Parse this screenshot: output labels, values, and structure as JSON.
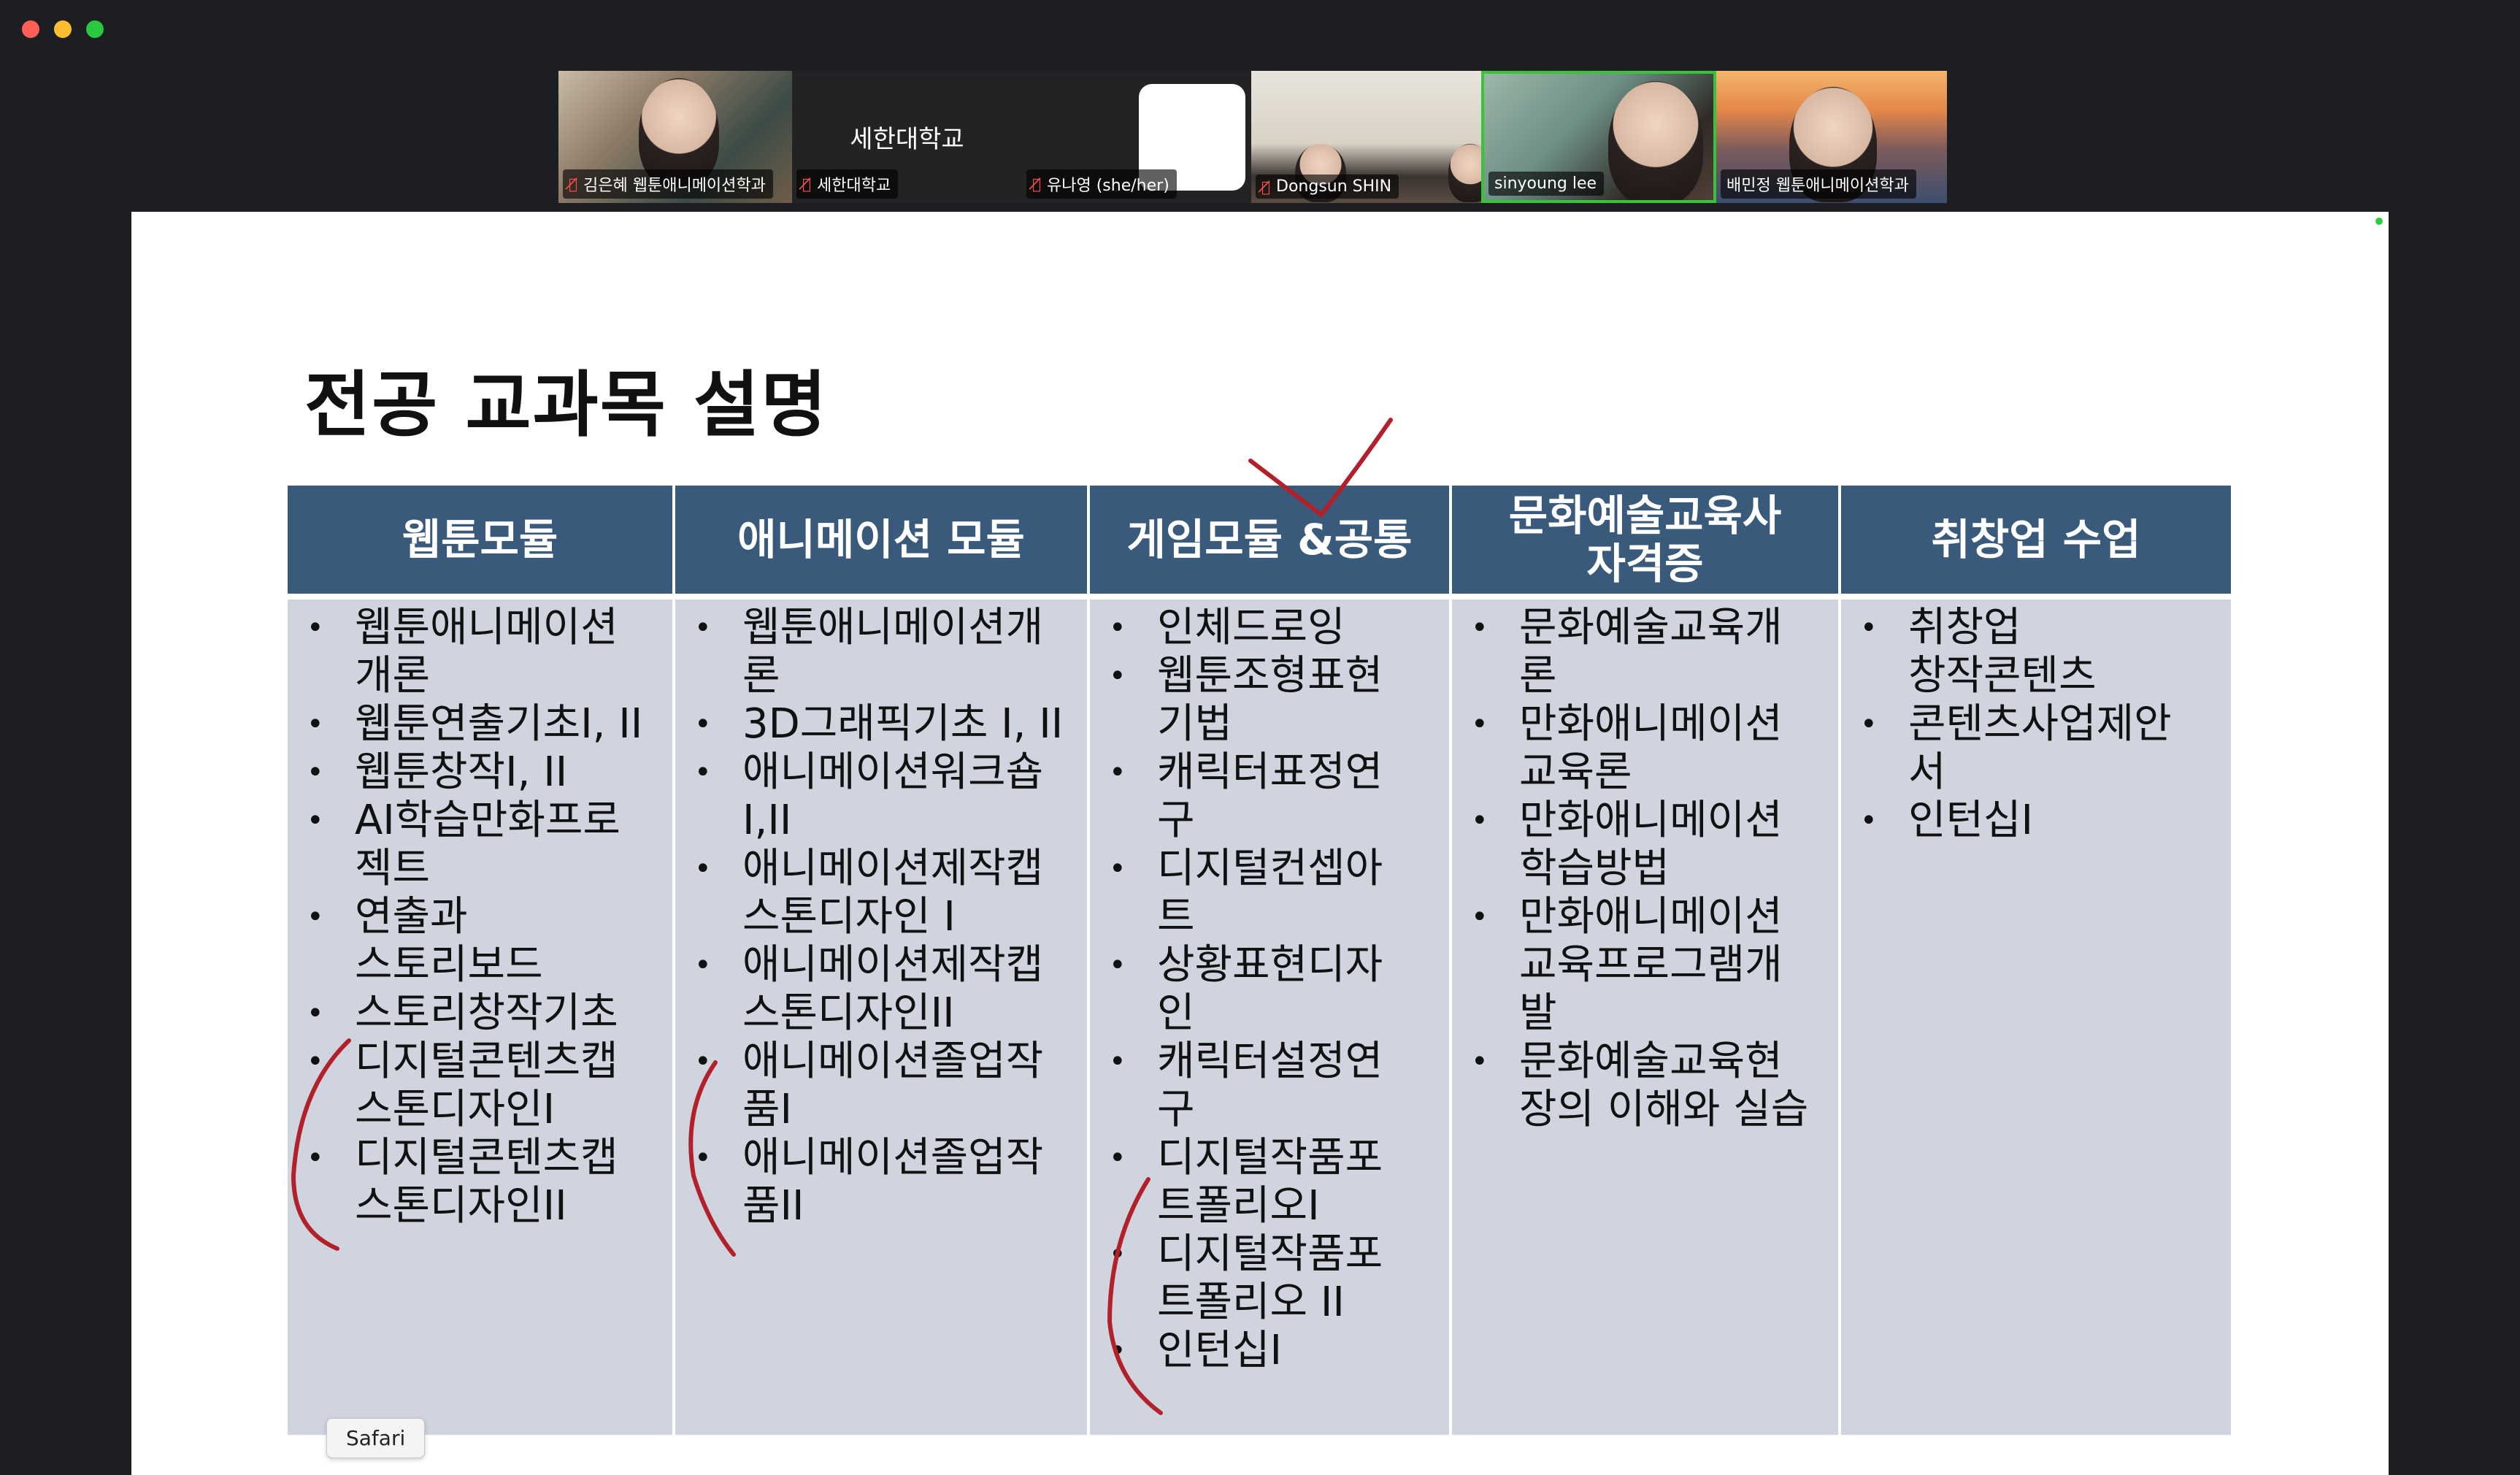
{
  "participants": [
    {
      "name": "김은혜 웹툰애니메이션학과",
      "muted": true
    },
    {
      "name": "세한대학교",
      "display_name": "세한대학교",
      "muted": true
    },
    {
      "name": "유나영 (she/her)",
      "muted": true
    },
    {
      "name": "Dongsun SHIN",
      "muted": true
    },
    {
      "name": "sinyoung lee",
      "muted": false,
      "active_speaker": true
    },
    {
      "name": "배민정 웹툰애니메이션학과",
      "muted": false
    }
  ],
  "slide": {
    "title": "전공 교과목 설명",
    "columns": [
      {
        "header": "웹툰모듈",
        "items": [
          "웹툰애니메이션\n개론",
          "웹툰연출기초I, II",
          "웹툰창작I, II",
          "AI학습만화프로\n젝트",
          "연출과\n스토리보드",
          "스토리창작기초",
          "디지털콘텐츠캡\n스톤디자인I",
          "디지털콘텐츠캡\n스톤디자인II"
        ]
      },
      {
        "header": "애니메이션 모듈",
        "items": [
          "웹툰애니메이션개\n론",
          "3D그래픽기초 I, II",
          "애니메이션워크숍\nI,II",
          "애니메이션제작캡\n스톤디자인 I",
          "애니메이션제작캡\n스톤디자인II",
          "애니메이션졸업작\n품I",
          "애니메이션졸업작\n품II"
        ]
      },
      {
        "header": "게임모듈 &공통",
        "items": [
          "인체드로잉",
          "웹툰조형표현\n기법",
          "캐릭터표정연\n구",
          "디지털컨셉아\n트",
          "상황표현디자\n인",
          "캐릭터설정연\n구",
          "디지털작품포\n트폴리오I",
          "디지털작품포\n트폴리오 II",
          "인턴십I"
        ]
      },
      {
        "header": "문화예술교육사\n자격증",
        "items": [
          "문화예술교육개\n론",
          "만화애니메이션\n교육론",
          "만화애니메이션\n학습방법",
          "만화애니메이션\n교육프로그램개\n발",
          "문화예술교육현\n장의 이해와 실습"
        ]
      },
      {
        "header": "취창업 수업",
        "items": [
          "취창업\n창작콘텐츠",
          "콘텐츠사업제안\n서",
          "인턴십I"
        ]
      }
    ]
  },
  "tooltip": "Safari",
  "colors": {
    "header_bg": "#3a5a7c",
    "body_bg": "#d0d4de",
    "annotation": "#b2202a",
    "active_speaker_border": "#3ac23a"
  }
}
